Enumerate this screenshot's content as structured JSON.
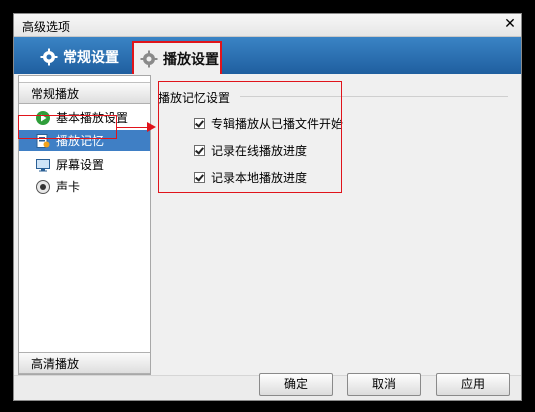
{
  "window": {
    "title": "高级选项",
    "close_label": "✕"
  },
  "tabs": [
    {
      "label": "常规设置",
      "icon": "gear-icon"
    },
    {
      "label": "播放设置",
      "icon": "gear-icon",
      "active": true
    }
  ],
  "sidebar": {
    "group_top": "常规播放",
    "items": [
      {
        "label": "基本播放设置",
        "icon": "play-circle-icon"
      },
      {
        "label": "播放记忆",
        "icon": "memory-icon",
        "selected": true
      },
      {
        "label": "屏幕设置",
        "icon": "monitor-icon"
      },
      {
        "label": "声卡",
        "icon": "speaker-icon"
      }
    ],
    "group_bottom": "高清播放"
  },
  "settings": {
    "group_title": "播放记忆设置",
    "options": [
      {
        "label": "专辑播放从已播文件开始",
        "checked": true
      },
      {
        "label": "记录在线播放进度",
        "checked": true
      },
      {
        "label": "记录本地播放进度",
        "checked": true
      }
    ]
  },
  "buttons": {
    "ok": "确定",
    "cancel": "取消",
    "apply": "应用"
  },
  "colors": {
    "accent": "#3f7fc5",
    "highlight": "#e0141b",
    "tabbar": "#2a6fb3"
  }
}
